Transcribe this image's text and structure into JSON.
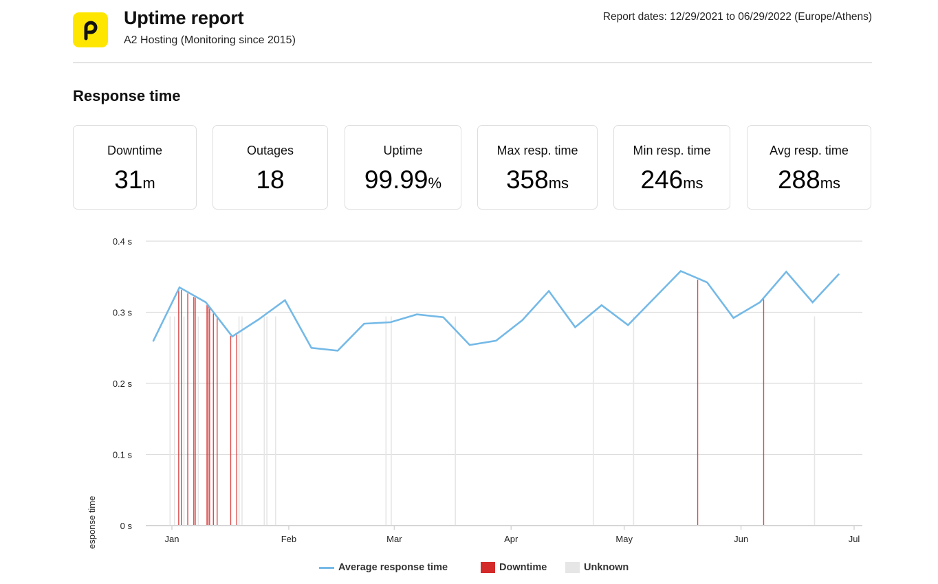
{
  "header": {
    "logo_icon": "pingdom-p-logo-icon",
    "title": "Uptime report",
    "subtitle": "A2 Hosting (Monitoring since 2015)",
    "report_dates": "Report dates: 12/29/2021 to 06/29/2022 (Europe/Athens)"
  },
  "section": {
    "title": "Response time"
  },
  "stats": [
    {
      "label": "Downtime",
      "value": "31",
      "unit": "m"
    },
    {
      "label": "Outages",
      "value": "18",
      "unit": ""
    },
    {
      "label": "Uptime",
      "value": "99.99",
      "unit": "%"
    },
    {
      "label": "Max resp. time",
      "value": "358",
      "unit": "ms"
    },
    {
      "label": "Min resp. time",
      "value": "246",
      "unit": "ms"
    },
    {
      "label": "Avg resp. time",
      "value": "288",
      "unit": "ms"
    }
  ],
  "colors": {
    "brand": "#ffe600",
    "line": "#74b9e7",
    "downtime": "#d42a2a",
    "unknown": "#e6e6e6",
    "grid": "#dddddd"
  },
  "chart_data": {
    "type": "line",
    "title": "",
    "xlabel": "",
    "ylabel": "Response time",
    "ylim": [
      0,
      0.4
    ],
    "y_ticks": [
      {
        "value": 0,
        "label": "0  s"
      },
      {
        "value": 0.1,
        "label": "0.1  s"
      },
      {
        "value": 0.2,
        "label": "0.2  s"
      },
      {
        "value": 0.3,
        "label": "0.3  s"
      },
      {
        "value": 0.4,
        "label": "0.4  s"
      }
    ],
    "x_range_days": [
      -7,
      183
    ],
    "x_ticks": [
      {
        "day": 0,
        "label": "Jan"
      },
      {
        "day": 31,
        "label": "Feb"
      },
      {
        "day": 59,
        "label": "Mar"
      },
      {
        "day": 90,
        "label": "Apr"
      },
      {
        "day": 120,
        "label": "May"
      },
      {
        "day": 151,
        "label": "Jun"
      },
      {
        "day": 181,
        "label": "Jul"
      }
    ],
    "x_unit": "days since Jan 1 2022",
    "grid": true,
    "legend_position": "bottom",
    "series": [
      {
        "name": "Average response time",
        "type": "line",
        "x": [
          -5,
          2,
          9,
          16,
          23,
          30,
          37,
          44,
          51,
          58,
          65,
          72,
          79,
          86,
          93,
          100,
          107,
          114,
          121,
          135,
          142,
          149,
          156,
          163,
          170,
          177
        ],
        "values": [
          0.259,
          0.335,
          0.314,
          0.266,
          0.29,
          0.317,
          0.25,
          0.246,
          0.284,
          0.286,
          0.297,
          0.293,
          0.254,
          0.26,
          0.289,
          0.33,
          0.279,
          0.31,
          0.282,
          0.358,
          0.342,
          0.292,
          0.314,
          0.357,
          0.314,
          0.354
        ]
      }
    ],
    "downtime_markers": {
      "name": "Downtime",
      "days": [
        1.8,
        2.5,
        4.2,
        5.8,
        6.2,
        9.3,
        9.6,
        10.0,
        11.0,
        12.0,
        15.6,
        17.2,
        139.5,
        157.0
      ]
    },
    "unknown_markers": {
      "name": "Unknown",
      "days": [
        -0.5,
        0.7,
        3.2,
        7.0,
        17.8,
        18.6,
        24.5,
        25.2,
        27.5,
        56.8,
        58.2,
        75.2,
        111.8,
        122.5,
        170.5
      ]
    },
    "legend": [
      "Average response time",
      "Downtime",
      "Unknown"
    ]
  }
}
